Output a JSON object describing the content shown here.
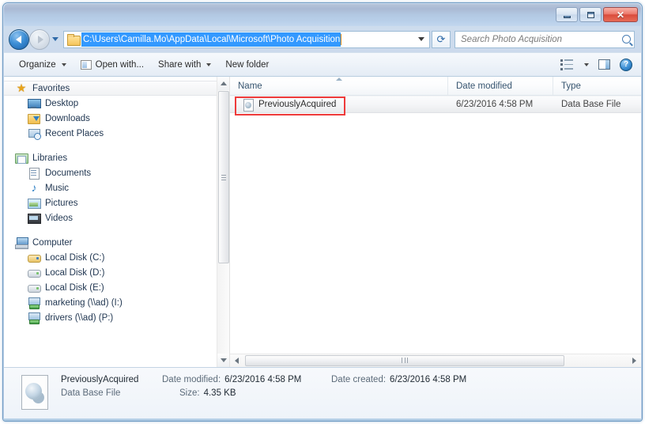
{
  "window": {
    "minimize_label": "Minimize",
    "maximize_label": "Maximize",
    "close_label": "✕"
  },
  "address": {
    "path": "C:\\Users\\Camilla.Mo\\AppData\\Local\\Microsoft\\Photo Acquisition",
    "refresh_glyph": "⟳",
    "dropdown_glyph": "▾"
  },
  "search": {
    "placeholder": "Search Photo Acquisition",
    "value": ""
  },
  "toolbar": {
    "organize": "Organize",
    "open_with": "Open with...",
    "share_with": "Share with",
    "new_folder": "New folder",
    "help_glyph": "?"
  },
  "sidebar": {
    "items": [
      {
        "label": "Favorites",
        "icon": "star-icon",
        "level": "header",
        "selected": true
      },
      {
        "label": "Desktop",
        "icon": "desktop-icon",
        "level": "child",
        "selected": false
      },
      {
        "label": "Downloads",
        "icon": "downloads-icon",
        "level": "child",
        "selected": false
      },
      {
        "label": "Recent Places",
        "icon": "recent-places-icon",
        "level": "child",
        "selected": false
      },
      {
        "label": "",
        "icon": "gap",
        "level": "gap",
        "selected": false
      },
      {
        "label": "Libraries",
        "icon": "libraries-icon",
        "level": "header",
        "selected": false
      },
      {
        "label": "Documents",
        "icon": "documents-icon",
        "level": "child",
        "selected": false
      },
      {
        "label": "Music",
        "icon": "music-icon",
        "level": "child",
        "selected": false
      },
      {
        "label": "Pictures",
        "icon": "pictures-icon",
        "level": "child",
        "selected": false
      },
      {
        "label": "Videos",
        "icon": "videos-icon",
        "level": "child",
        "selected": false
      },
      {
        "label": "",
        "icon": "gap",
        "level": "gap",
        "selected": false
      },
      {
        "label": "Computer",
        "icon": "computer-icon",
        "level": "header",
        "selected": false
      },
      {
        "label": "Local Disk (C:)",
        "icon": "system-disk-icon",
        "level": "child",
        "selected": false
      },
      {
        "label": "Local Disk (D:)",
        "icon": "disk-icon",
        "level": "child",
        "selected": false
      },
      {
        "label": "Local Disk (E:)",
        "icon": "disk-icon",
        "level": "child",
        "selected": false
      },
      {
        "label": "marketing (\\\\ad) (I:)",
        "icon": "network-drive-icon",
        "level": "child",
        "selected": false
      },
      {
        "label": "drivers (\\\\ad) (P:)",
        "icon": "network-drive-icon",
        "level": "child",
        "selected": false
      }
    ]
  },
  "filelist": {
    "columns": [
      {
        "label": "Name",
        "sorted": "asc"
      },
      {
        "label": "Date modified",
        "sorted": ""
      },
      {
        "label": "Type",
        "sorted": ""
      }
    ],
    "rows": [
      {
        "name": "PreviouslyAcquired",
        "date_modified": "6/23/2016 4:58 PM",
        "type": "Data Base File",
        "highlighted": true
      }
    ]
  },
  "details": {
    "name": "PreviouslyAcquired",
    "type": "Data Base File",
    "date_modified_label": "Date modified:",
    "date_modified_value": "6/23/2016 4:58 PM",
    "size_label": "Size:",
    "size_value": "4.35 KB",
    "date_created_label": "Date created:",
    "date_created_value": "6/23/2016 4:58 PM"
  },
  "colors": {
    "selection_blue": "#3399ff",
    "annotation_red": "#ee3b3b",
    "title_blue": "#b2c8e2"
  }
}
